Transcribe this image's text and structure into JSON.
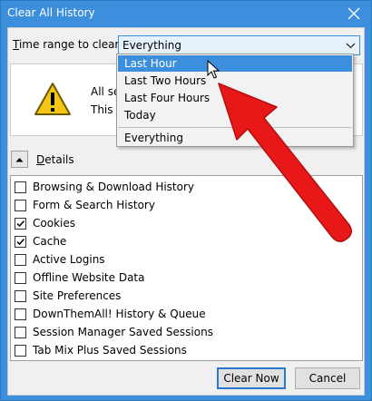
{
  "window": {
    "title": "Clear All History"
  },
  "time_range": {
    "label_prefix": "T",
    "label_rest": "ime range to clear:",
    "selected": "Everything",
    "options": [
      "Last Hour",
      "Last Two Hours",
      "Last Four Hours",
      "Today",
      "Everything"
    ],
    "highlighted": "Last Hour"
  },
  "warning": {
    "line1": "All sel",
    "line2": "This ac"
  },
  "details": {
    "label_prefix": "D",
    "label_rest": "etails"
  },
  "items": [
    {
      "label": "Browsing & Download History",
      "checked": false
    },
    {
      "label": "Form & Search History",
      "checked": false
    },
    {
      "label": "Cookies",
      "checked": true
    },
    {
      "label": "Cache",
      "checked": true
    },
    {
      "label": "Active Logins",
      "checked": false
    },
    {
      "label": "Offline Website Data",
      "checked": false
    },
    {
      "label": "Site Preferences",
      "checked": false
    },
    {
      "label": "DownThemAll! History & Queue",
      "checked": false
    },
    {
      "label": "Session Manager Saved Sessions",
      "checked": false
    },
    {
      "label": "Tab Mix Plus Saved Sessions",
      "checked": false
    }
  ],
  "buttons": {
    "clear_now": "Clear Now",
    "cancel": "Cancel"
  },
  "colors": {
    "titlebar": "#3c8fdc",
    "highlight": "#3b8fdc",
    "annotation_arrow": "#e81818"
  }
}
